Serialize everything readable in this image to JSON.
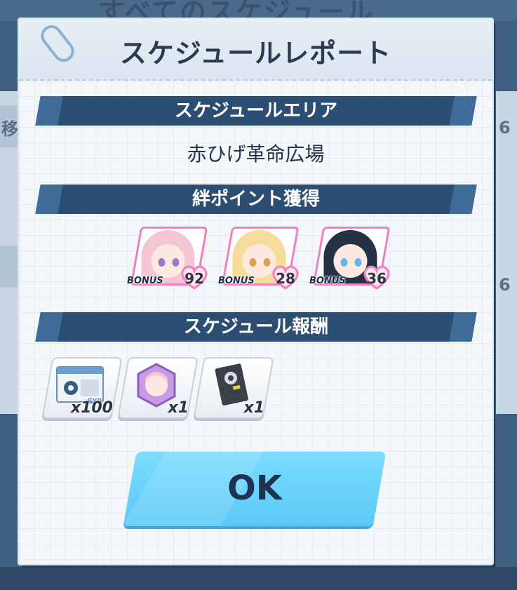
{
  "background": {
    "title_fragment": "すべてのスケジュール",
    "side_value_1": "6",
    "side_value_2": "6",
    "side_left_text": "移"
  },
  "modal": {
    "title": "スケジュールレポート",
    "sections": {
      "area": {
        "header": "スケジュールエリア",
        "value": "赤ひげ革命広場"
      },
      "bond": {
        "header": "絆ポイント獲得",
        "characters": [
          {
            "bonus_label": "BONUS",
            "points": "92",
            "hair_color": "#f4c6d4",
            "eye_color": "#9a7bbf"
          },
          {
            "bonus_label": "BONUS",
            "points": "28",
            "hair_color": "#f5dc9a",
            "eye_color": "#d9a24f"
          },
          {
            "bonus_label": "BONUS",
            "points": "36",
            "hair_color": "#253246",
            "eye_color": "#5fb8e8"
          }
        ]
      },
      "rewards": {
        "header": "スケジュール報酬",
        "items": [
          {
            "name": "exp-report-icon",
            "quantity": "x100",
            "badge": "EXP"
          },
          {
            "name": "character-elephant-icon",
            "quantity": "x1"
          },
          {
            "name": "gear-book-icon",
            "quantity": "x1"
          }
        ]
      }
    },
    "ok_label": "OK"
  },
  "colors": {
    "section_bar": "#2c4e72",
    "ok_button": "#6fd4fb",
    "heart": "#f07fbf"
  }
}
